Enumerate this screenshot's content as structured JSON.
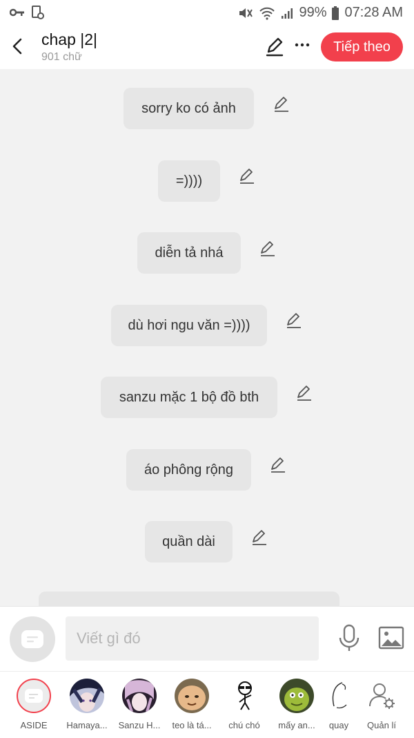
{
  "status_bar": {
    "battery": "99%",
    "time": "07:28 AM"
  },
  "header": {
    "title": "chap |2|",
    "subtitle": "901 chữ",
    "next_label": "Tiếp theo"
  },
  "messages": [
    "sorry ko có ảnh",
    "=))))",
    "diễn tả nhá",
    "dù hơi ngu văn =))))",
    "sanzu mặc 1 bộ đồ bth",
    "áo phông rộng",
    "quần dài"
  ],
  "composer": {
    "placeholder": "Viết gì đó"
  },
  "characters": [
    {
      "name": "ASIDE",
      "icon": "chat-bubble-icon"
    },
    {
      "name": "Hamaya...",
      "icon": "avatar"
    },
    {
      "name": "Sanzu H...",
      "icon": "avatar"
    },
    {
      "name": "teo là tá...",
      "icon": "avatar"
    },
    {
      "name": "chú chó",
      "icon": "stick-figure-avatar"
    },
    {
      "name": "mấy an...",
      "icon": "avatar"
    },
    {
      "name": "quay",
      "icon": "sketch-avatar"
    },
    {
      "name": "Quản lí",
      "icon": "user-settings-icon"
    }
  ],
  "colors": {
    "accent": "#f2404c",
    "bubble": "#e6e6e6",
    "background": "#f2f2f2"
  }
}
